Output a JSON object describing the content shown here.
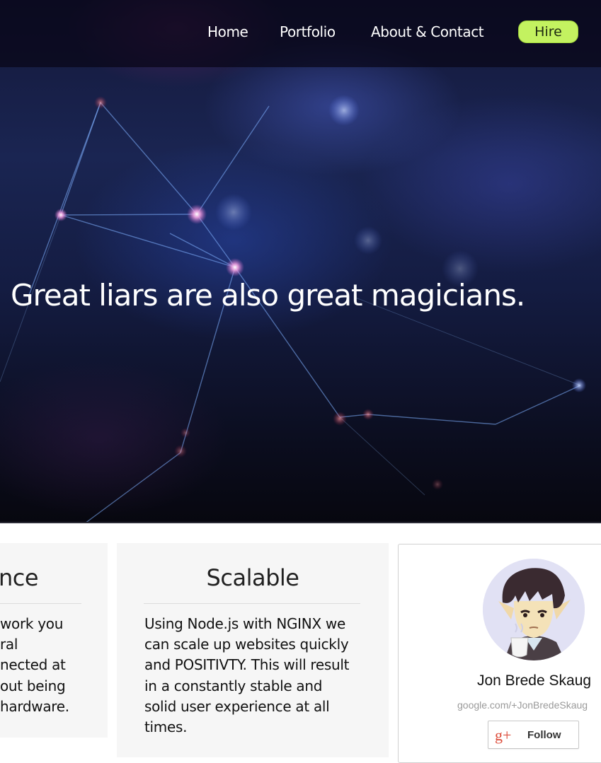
{
  "nav": {
    "items": [
      {
        "label": "Home"
      },
      {
        "label": "Portfolio"
      },
      {
        "label": "About & Contact"
      }
    ],
    "hire_label": "Hire",
    "hire_color": "#c3f260"
  },
  "hero": {
    "tagline": "Great liars are also great magicians."
  },
  "cards": [
    {
      "title": "nce",
      "lines": [
        "work you",
        "ral",
        "nected at",
        "out being",
        "hardware."
      ]
    },
    {
      "title": "Scalable",
      "lines": [
        "Using Node.js with NGINX we",
        "can scale up websites quickly",
        "and POSITIVTY. This will result",
        "in a constantly stable and",
        "solid user experience at all",
        "times."
      ]
    }
  ],
  "gplus_badge": {
    "name": "Jon Brede Skaug",
    "url": "google.com/+JonBredeSkaug",
    "follow_label": "Follow",
    "logo_text": "g+",
    "logo_color": "#dd4b39"
  }
}
